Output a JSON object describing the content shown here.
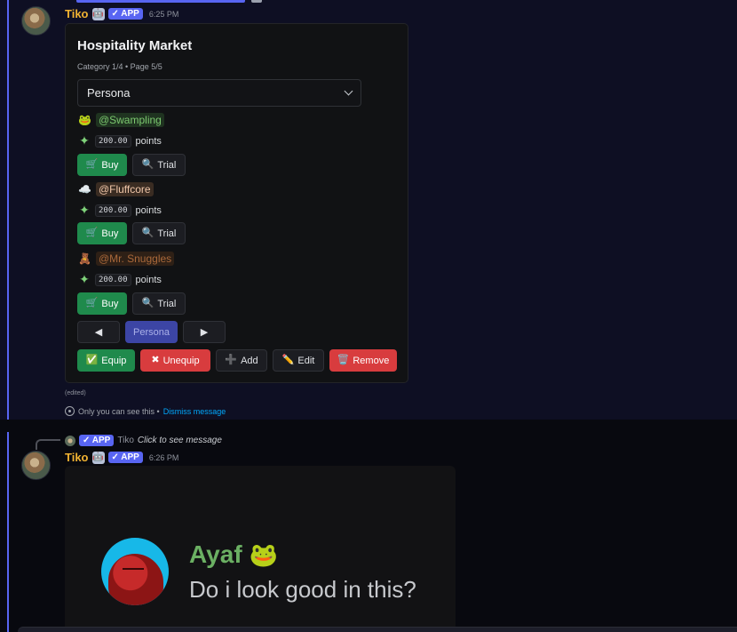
{
  "message1": {
    "username": "Tiko",
    "app_badge": "✓ APP",
    "time": "6:25 PM",
    "embed": {
      "title": "Hospitality Market",
      "subtitle": "Category 1/4 • Page 5/5",
      "select_value": "Persona",
      "items": [
        {
          "emoji": "🐸",
          "role": "@Swampling",
          "role_color": "#7cc96f",
          "role_bg": "#1f3320",
          "price": "200.00",
          "points_label": "points"
        },
        {
          "emoji": "☁️",
          "role": "@Fluffcore",
          "role_color": "#f0c6a8",
          "role_bg": "#3a2c22",
          "price": "200.00",
          "points_label": "points"
        },
        {
          "emoji": "🧸",
          "role": "@Mr. Snuggles",
          "role_color": "#a9683a",
          "role_bg": "#2e2016",
          "price": "200.00",
          "points_label": "points"
        }
      ],
      "buy_label": "Buy",
      "trial_label": "Trial",
      "prev_label": "◀",
      "page_button_label": "Persona",
      "next_label": "▶",
      "equip_label": "Equip",
      "unequip_label": "Unequip",
      "add_label": "Add",
      "edit_label": "Edit",
      "remove_label": "Remove"
    },
    "edited_label": "(edited)",
    "ephemeral_text": "Only you can see this •",
    "dismiss_label": "Dismiss message"
  },
  "message2": {
    "reply_app_badge": "✓ APP",
    "reply_name": "Tiko",
    "reply_text": "Click to see message",
    "username": "Tiko",
    "app_badge": "✓ APP",
    "time": "6:26 PM",
    "quote_name": "Ayaf",
    "quote_emoji": "🐸",
    "quote_text": "Do i look good in this?"
  },
  "colors": {
    "accent": "#5865f2",
    "success": "#1f8a4c",
    "danger": "#d83c3e",
    "username": "#f0b232"
  }
}
